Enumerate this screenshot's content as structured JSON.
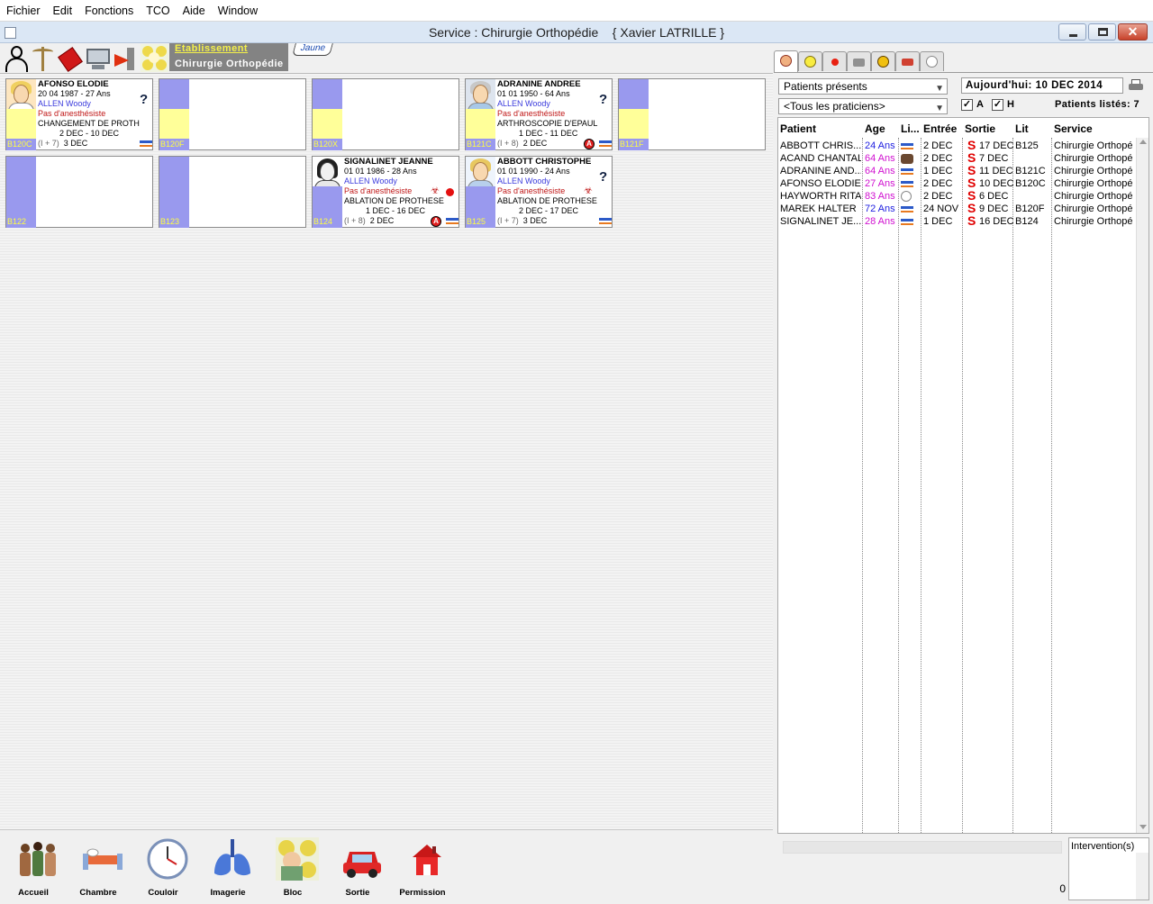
{
  "menu": [
    "Fichier",
    "Edit",
    "Fonctions",
    "TCO",
    "Aide",
    "Window"
  ],
  "window": {
    "title": "Service : Chirurgie Orthopédie    { Xavier LATRILLE }",
    "close_glyph": "✕"
  },
  "toolbar": {
    "estab_line1": "Etablissement",
    "estab_line2": "Chirurgie Orthopédie",
    "color_tab": "Jaune"
  },
  "rooms": [
    {
      "bed": "B120C",
      "occupied": true,
      "name": "AFONSO ELODIE",
      "dob": "20 04 1987 - 27 Ans",
      "doctor": "ALLEN Woody",
      "anest": "Pas d'anesthésiste",
      "procedure": "CHANGEMENT DE PROTH",
      "dates": "2 DEC - 10 DEC",
      "stay": "(I + 7)",
      "stay_date": "3 DEC",
      "icons": [
        "question-icon",
        "bed-icon"
      ]
    },
    {
      "bed": "B120F",
      "occupied": false
    },
    {
      "bed": "B120X",
      "occupied": false
    },
    {
      "bed": "B121C",
      "occupied": true,
      "name": "ADRANINE ANDREE",
      "dob": "01 01 1950 - 64 Ans",
      "doctor": "ALLEN Woody",
      "anest": "Pas d'anesthésiste",
      "procedure": "ARTHROSCOPIE D'EPAUL",
      "dates": "1 DEC - 11 DEC",
      "stay": "(I + 8)",
      "stay_date": "2 DEC",
      "icons": [
        "question-icon",
        "anesthesia-icon",
        "bed-icon"
      ]
    },
    {
      "bed": "B121F",
      "occupied": false
    },
    {
      "bed": "B122",
      "occupied": false
    },
    {
      "bed": "B123",
      "occupied": false
    },
    {
      "bed": "B124",
      "occupied": true,
      "name": "SIGNALINET JEANNE",
      "dob": "01 01 1986 - 28 Ans",
      "doctor": "ALLEN Woody",
      "anest": "Pas d'anesthésiste",
      "procedure": "ABLATION DE PROTHESE",
      "dates": "1 DEC - 16 DEC",
      "stay": "(I + 8)",
      "stay_date": "2 DEC",
      "icons": [
        "biohazard-icon",
        "red-dot-icon",
        "anesthesia-icon",
        "bed-icon"
      ]
    },
    {
      "bed": "B125",
      "occupied": true,
      "name": "ABBOTT CHRISTOPHE",
      "dob": "01 01 1990 - 24 Ans",
      "doctor": "ALLEN Woody",
      "anest": "Pas d'anesthésiste",
      "procedure": "ABLATION DE PROTHESE",
      "dates": "2 DEC - 17 DEC",
      "stay": "(I + 7)",
      "stay_date": "3 DEC",
      "icons": [
        "question-icon",
        "biohazard-icon",
        "bed-icon"
      ]
    }
  ],
  "nav": [
    "Accueil",
    "Chambre",
    "Couloir",
    "Imagerie",
    "Bloc",
    "Sortie",
    "Permission"
  ],
  "right": {
    "filter_patients": "Patients présents",
    "filter_practitioners": "<Tous les praticiens>",
    "today": "Aujourd'hui: 10 DEC 2014",
    "check_a": "A",
    "check_h": "H",
    "check_mark": "✓",
    "listed": "Patients listés: 7",
    "columns": [
      "Patient",
      "Age",
      "Li...",
      "Entrée",
      "Sortie",
      "Lit",
      "Service"
    ],
    "patients": [
      {
        "name": "ABBOTT CHRIS...",
        "age": "24 Ans",
        "age_color": "blue",
        "li": "bed",
        "entree": "2 DEC",
        "s": "S",
        "sortie": "17 DEC",
        "lit": "B125",
        "service": "Chirurgie Orthopé"
      },
      {
        "name": "ACAND CHANTAL",
        "age": "64 Ans",
        "age_color": "magenta",
        "li": "people",
        "entree": "2 DEC",
        "s": "S",
        "sortie": "7 DEC",
        "lit": "",
        "service": "Chirurgie Orthopé"
      },
      {
        "name": "ADRANINE AND...",
        "age": "64 Ans",
        "age_color": "magenta",
        "li": "bed",
        "entree": "1 DEC",
        "s": "S",
        "sortie": "11 DEC",
        "lit": "B121C",
        "service": "Chirurgie Orthopé"
      },
      {
        "name": "AFONSO ELODIE",
        "age": "27 Ans",
        "age_color": "magenta",
        "li": "bed",
        "entree": "2 DEC",
        "s": "S",
        "sortie": "10 DEC",
        "lit": "B120C",
        "service": "Chirurgie Orthopé"
      },
      {
        "name": "HAYWORTH RITA",
        "age": "83 Ans",
        "age_color": "magenta",
        "li": "clock",
        "entree": "2 DEC",
        "s": "S",
        "sortie": "6 DEC",
        "lit": "",
        "service": "Chirurgie Orthopé"
      },
      {
        "name": "MAREK HALTER",
        "age": "72 Ans",
        "age_color": "blue",
        "li": "bed",
        "entree": "24 NOV",
        "s": "S",
        "sortie": "9 DEC",
        "lit": "B120F",
        "service": "Chirurgie Orthopé"
      },
      {
        "name": "SIGNALINET JE...",
        "age": "28 Ans",
        "age_color": "magenta",
        "li": "bed",
        "entree": "1 DEC",
        "s": "S",
        "sortie": "16 DEC",
        "lit": "B124",
        "service": "Chirurgie Orthopé"
      }
    ],
    "count": "0",
    "interventions": "Intervention(s)"
  },
  "colors": {
    "bed_blue": "#9999ee",
    "bed_yellow": "#ffff99",
    "estab_gray": "#838383",
    "sortie_red": "#e00000"
  }
}
